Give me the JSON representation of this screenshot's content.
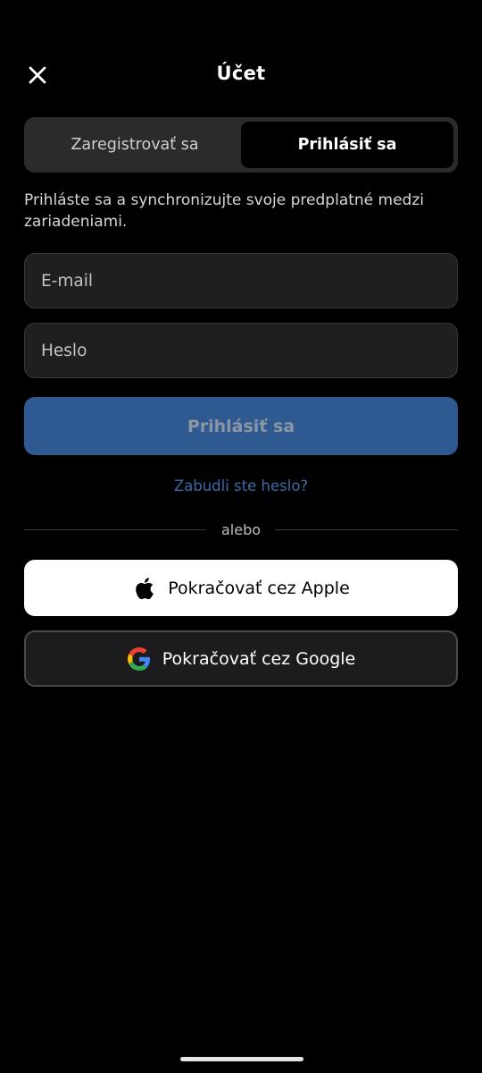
{
  "header": {
    "title": "Účet",
    "close_icon": "close-icon"
  },
  "segmented": {
    "register_label": "Zaregistrovať sa",
    "login_label": "Prihlásiť sa",
    "selected": "login"
  },
  "subtitle": "Prihláste sa a synchronizujte svoje predplatné medzi zariadeniami.",
  "form": {
    "email_placeholder": "E-mail",
    "email_value": "",
    "password_placeholder": "Heslo",
    "password_value": "",
    "submit_label": "Prihlásiť sa",
    "forgot_label": "Zabudli ste heslo?"
  },
  "divider_label": "alebo",
  "social": {
    "apple_label": "Pokračovať cez Apple",
    "apple_icon": "apple-icon",
    "google_label": "Pokračovať cez Google",
    "google_icon": "google-icon"
  },
  "colors": {
    "background": "#000000",
    "primary_button": "#2e5a91",
    "link": "#3a6ba8",
    "input_bg": "#1f1f21"
  }
}
